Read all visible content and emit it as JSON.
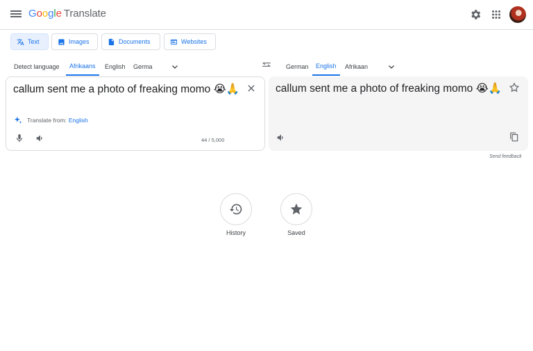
{
  "header": {
    "menu_icon": "hamburger-menu-icon",
    "logo_letters": [
      "G",
      "o",
      "o",
      "g",
      "l",
      "e"
    ],
    "app_name": "Translate",
    "settings_icon": "gear-icon",
    "apps_icon": "apps-grid-icon",
    "avatar_icon": "account-avatar"
  },
  "modes": [
    {
      "label": "Text",
      "icon": "translate-icon",
      "active": true
    },
    {
      "label": "Images",
      "icon": "image-icon",
      "active": false
    },
    {
      "label": "Documents",
      "icon": "document-icon",
      "active": false
    },
    {
      "label": "Websites",
      "icon": "website-icon",
      "active": false
    }
  ],
  "source_langs": [
    {
      "label": "Detect language",
      "active": false
    },
    {
      "label": "Afrikaans",
      "active": true
    },
    {
      "label": "English",
      "active": false
    },
    {
      "label": "Germa",
      "active": false
    }
  ],
  "target_langs": [
    {
      "label": "German",
      "active": false
    },
    {
      "label": "English",
      "active": true
    },
    {
      "label": "Afrikaan",
      "active": false
    }
  ],
  "source": {
    "text": "callum sent me a photo of freaking momo 😭🙏",
    "translate_from_prefix": "Translate from:",
    "translate_from_lang": "English",
    "char_count": "44 / 5,000"
  },
  "target": {
    "text": "callum sent me a photo of freaking momo 😭🙏"
  },
  "feedback": "Send feedback",
  "bottom": {
    "history_label": "History",
    "saved_label": "Saved"
  },
  "colors": {
    "accent": "#1a73e8",
    "border": "#dadce0",
    "target_bg": "#f5f5f5"
  }
}
